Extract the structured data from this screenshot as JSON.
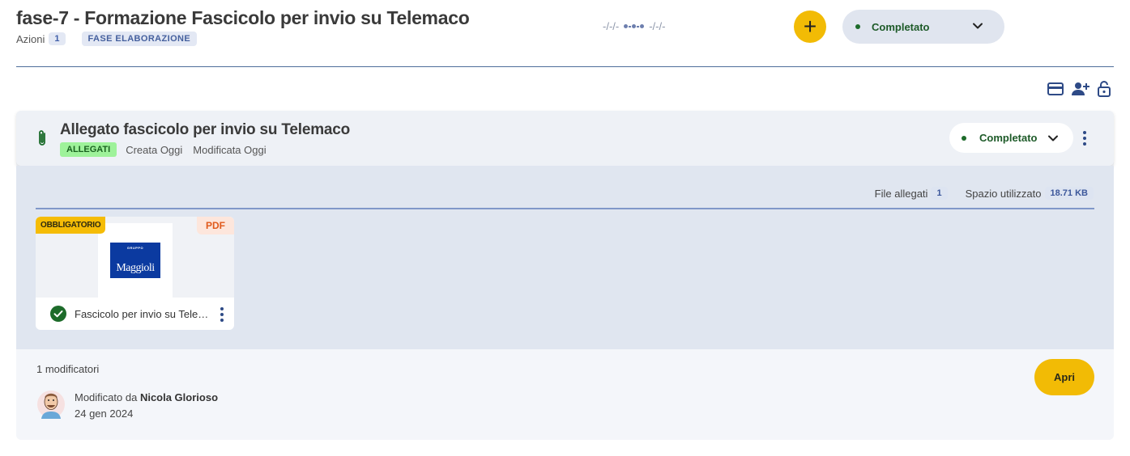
{
  "header": {
    "title": "fase-7 - Formazione Fascicolo per invio su Telemaco",
    "azioni_label": "Azioni",
    "azioni_count": "1",
    "fase_tag": "FASE ELABORAZIONE",
    "date_start": "-/-/-",
    "date_end": "-/-/-",
    "add_symbol": "+",
    "status": "Completato",
    "status_color": "#1d6b2a"
  },
  "toolbar": {
    "icons": [
      "card-icon",
      "add-user-icon",
      "unlock-icon"
    ]
  },
  "card": {
    "icon": "paperclip-icon",
    "title": "Allegato fascicolo per invio su Telemaco",
    "tag": "ALLEGATI",
    "created": "Creata Oggi",
    "modified": "Modificata Oggi",
    "status": "Completato",
    "files_label": "File allegati",
    "files_count": "1",
    "space_label": "Spazio utilizzato",
    "space_value": "18.71 KB",
    "file": {
      "required_tag": "OBBLIGATORIO",
      "type_tag": "PDF",
      "logo_top": "GRUPPO",
      "logo_main": "Maggioli",
      "name": "Fascicolo per invio su Telemaco"
    },
    "modifiers_label": "1 modificatori",
    "modified_by_prefix": "Modificato da",
    "modified_by_name": "Nicola Glorioso",
    "modified_date": "24 gen 2024",
    "open_label": "Apri"
  },
  "colors": {
    "accent_yellow": "#f2bb05",
    "primary_blue": "#2e4a86",
    "success_green": "#1d6b2a"
  }
}
